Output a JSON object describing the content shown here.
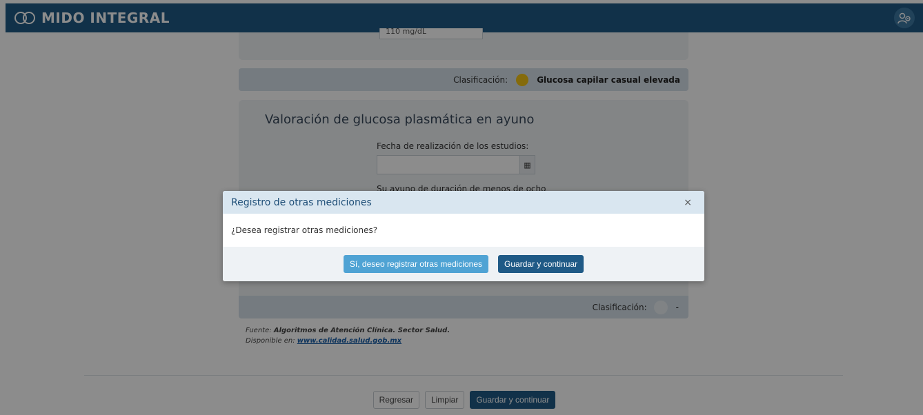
{
  "navbar": {
    "brand": "MIDO INTEGRAL",
    "logo_icon": "infinity-logo-icon",
    "user_icon": "user-settings-icon",
    "color": "#1f5a86"
  },
  "top_card": {
    "partial_value": "110 mg/dL"
  },
  "classification_1": {
    "label": "Clasificación:",
    "value": "Glucosa capilar casual elevada",
    "indicator_color": "#f2c417"
  },
  "section": {
    "title": "Valoración de glucosa plasmática en ayuno",
    "date_label": "Fecha de realización de los estudios:",
    "date_value": "",
    "calendar_icon": "calendar-icon",
    "second_label": "Su ayuno de duración de menos de ocho"
  },
  "classification_2": {
    "label": "Clasificación:",
    "value": "-"
  },
  "source": {
    "prefix": "Fuente:",
    "text": "Algoritmos de Atención Clínica. Sector Salud.",
    "available_prefix": "Disponible en:",
    "link": "www.calidad.salud.gob.mx"
  },
  "bottom_buttons": {
    "back": "Regresar",
    "clear": "Limpiar",
    "save": "Guardar y continuar"
  },
  "modal": {
    "title": "Registro de otras mediciones",
    "close": "×",
    "question": "¿Desea registrar otras mediciones?",
    "yes_button": "Sí, deseo registrar otras mediciones",
    "save_button": "Guardar y continuar"
  }
}
